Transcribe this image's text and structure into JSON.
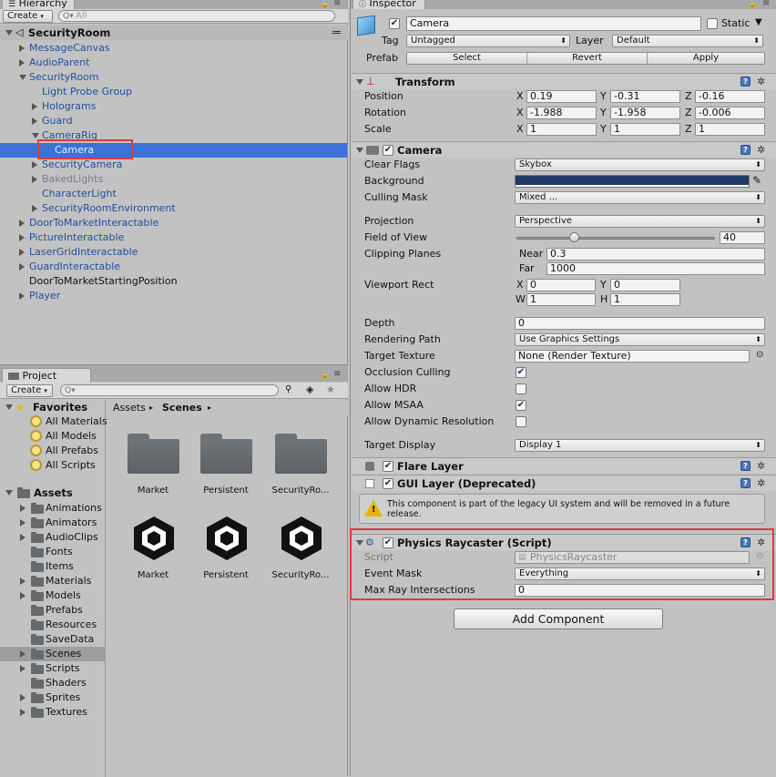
{
  "hierarchy": {
    "tab_label": "Hierarchy",
    "create_label": "Create",
    "search_placeholder": "All",
    "scene_name": "SecurityRoom",
    "items": [
      {
        "label": "MessageCanvas",
        "indent": 0,
        "state": "collapsed",
        "style": "blue"
      },
      {
        "label": "AudioParent",
        "indent": 0,
        "state": "collapsed",
        "style": "blue"
      },
      {
        "label": "SecurityRoom",
        "indent": 0,
        "state": "expanded",
        "style": "blue"
      },
      {
        "label": "Light Probe Group",
        "indent": 1,
        "state": "none",
        "style": "blue"
      },
      {
        "label": "Holograms",
        "indent": 1,
        "state": "collapsed",
        "style": "blue"
      },
      {
        "label": "Guard",
        "indent": 1,
        "state": "collapsed",
        "style": "blue"
      },
      {
        "label": "CameraRig",
        "indent": 1,
        "state": "expanded",
        "style": "blue"
      },
      {
        "label": "Camera",
        "indent": 2,
        "state": "none",
        "style": "selected"
      },
      {
        "label": "SecurityCamera",
        "indent": 1,
        "state": "collapsed",
        "style": "blue"
      },
      {
        "label": "BakedLights",
        "indent": 1,
        "state": "collapsed",
        "style": "gray"
      },
      {
        "label": "CharacterLight",
        "indent": 1,
        "state": "none",
        "style": "blue"
      },
      {
        "label": "SecurityRoomEnvironment",
        "indent": 1,
        "state": "collapsed",
        "style": "blue"
      },
      {
        "label": "DoorToMarketInteractable",
        "indent": 0,
        "state": "collapsed",
        "style": "blue"
      },
      {
        "label": "PictureInteractable",
        "indent": 0,
        "state": "collapsed",
        "style": "blue"
      },
      {
        "label": "LaserGridInteractable",
        "indent": 0,
        "state": "collapsed",
        "style": "blue"
      },
      {
        "label": "GuardInteractable",
        "indent": 0,
        "state": "collapsed",
        "style": "blue"
      },
      {
        "label": "DoorToMarketStartingPosition",
        "indent": 0,
        "state": "none",
        "style": "black"
      },
      {
        "label": "Player",
        "indent": 0,
        "state": "collapsed",
        "style": "blue"
      }
    ]
  },
  "project": {
    "tab_label": "Project",
    "create_label": "Create",
    "favorites_label": "Favorites",
    "favorites": [
      "All Materials",
      "All Models",
      "All Prefabs",
      "All Scripts"
    ],
    "assets_label": "Assets",
    "folders": [
      {
        "label": "Animations",
        "arrow": true
      },
      {
        "label": "Animators",
        "arrow": true
      },
      {
        "label": "AudioClips",
        "arrow": true
      },
      {
        "label": "Fonts",
        "arrow": false
      },
      {
        "label": "Items",
        "arrow": false
      },
      {
        "label": "Materials",
        "arrow": true
      },
      {
        "label": "Models",
        "arrow": true
      },
      {
        "label": "Prefabs",
        "arrow": false
      },
      {
        "label": "Resources",
        "arrow": false
      },
      {
        "label": "SaveData",
        "arrow": false
      },
      {
        "label": "Scenes",
        "arrow": true
      },
      {
        "label": "Scripts",
        "arrow": true
      },
      {
        "label": "Shaders",
        "arrow": false
      },
      {
        "label": "Sprites",
        "arrow": true
      },
      {
        "label": "Textures",
        "arrow": true
      }
    ],
    "selected_folder": "Scenes",
    "breadcrumb": [
      "Assets",
      "Scenes"
    ],
    "grid_folders": [
      "Market",
      "Persistent",
      "SecurityRo..."
    ],
    "grid_scenes": [
      "Market",
      "Persistent",
      "SecurityRo..."
    ]
  },
  "inspector": {
    "tab_label": "Inspector",
    "object_name": "Camera",
    "static_label": "Static",
    "tag_label": "Tag",
    "tag_value": "Untagged",
    "layer_label": "Layer",
    "layer_value": "Default",
    "prefab_label": "Prefab",
    "prefab_buttons": [
      "Select",
      "Revert",
      "Apply"
    ],
    "transform": {
      "title": "Transform",
      "rows": [
        {
          "label": "Position",
          "x": "0.19",
          "y": "-0.31",
          "z": "-0.16"
        },
        {
          "label": "Rotation",
          "x": "-1.988",
          "y": "-1.958",
          "z": "-0.006"
        },
        {
          "label": "Scale",
          "x": "1",
          "y": "1",
          "z": "1"
        }
      ]
    },
    "camera": {
      "title": "Camera",
      "clear_flags_label": "Clear Flags",
      "clear_flags_value": "Skybox",
      "background_label": "Background",
      "background_color": "#1f3a66",
      "culling_mask_label": "Culling Mask",
      "culling_mask_value": "Mixed ...",
      "projection_label": "Projection",
      "projection_value": "Perspective",
      "fov_label": "Field of View",
      "fov_value": "40",
      "fov_fraction": 0.29,
      "clipping_label": "Clipping Planes",
      "near_label": "Near",
      "near_value": "0.3",
      "far_label": "Far",
      "far_value": "1000",
      "viewport_label": "Viewport Rect",
      "vp_x": "0",
      "vp_y": "0",
      "vp_w": "1",
      "vp_h": "1",
      "depth_label": "Depth",
      "depth_value": "0",
      "rendering_path_label": "Rendering Path",
      "rendering_path_value": "Use Graphics Settings",
      "target_texture_label": "Target Texture",
      "target_texture_value": "None (Render Texture)",
      "occlusion_label": "Occlusion Culling",
      "hdr_label": "Allow HDR",
      "msaa_label": "Allow MSAA",
      "dynres_label": "Allow Dynamic Resolution",
      "target_display_label": "Target Display",
      "target_display_value": "Display 1"
    },
    "flare_layer_title": "Flare Layer",
    "gui_layer_title": "GUI Layer (Deprecated)",
    "gui_warning": "This component is part of the legacy UI system and will be removed in a future release.",
    "physics_raycaster": {
      "title": "Physics Raycaster (Script)",
      "script_label": "Script",
      "script_value": "PhysicsRaycaster",
      "event_mask_label": "Event Mask",
      "event_mask_value": "Everything",
      "max_ray_label": "Max Ray Intersections",
      "max_ray_value": "0"
    },
    "add_component_label": "Add Component"
  },
  "colors": {
    "selection": "#3a72d8",
    "highlight_box": "#e0393e",
    "help_blue": "#4a78b8"
  }
}
